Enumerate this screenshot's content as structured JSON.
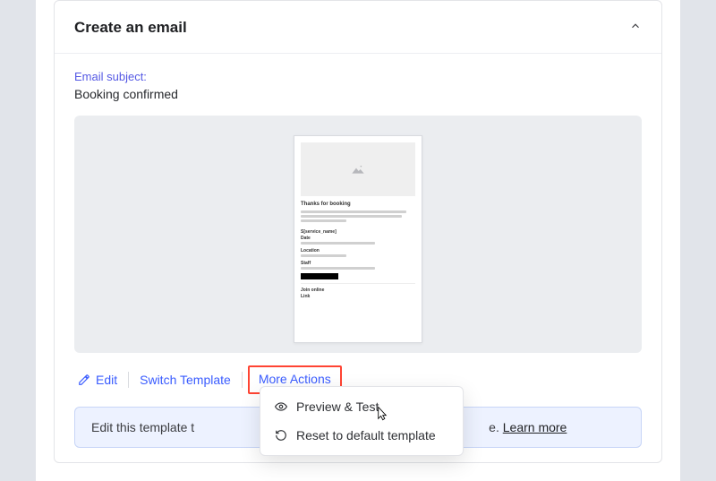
{
  "panel": {
    "title": "Create an email",
    "subject_label": "Email subject:",
    "subject_value": "Booking confirmed"
  },
  "preview": {
    "heading": "Thanks for booking",
    "section_label": "S[service_name]",
    "labels": {
      "date": "Date",
      "location": "Location",
      "staff": "Staff",
      "join": "Join online",
      "link": "Link"
    }
  },
  "actions": {
    "edit": "Edit",
    "switch_template": "Switch Template",
    "more_actions": "More Actions"
  },
  "tip": {
    "text_truncated": "Edit this template t",
    "text_end": "e. ",
    "learn_more": "Learn more"
  },
  "dropdown": {
    "preview_test": "Preview & Test",
    "reset": "Reset to default template"
  }
}
